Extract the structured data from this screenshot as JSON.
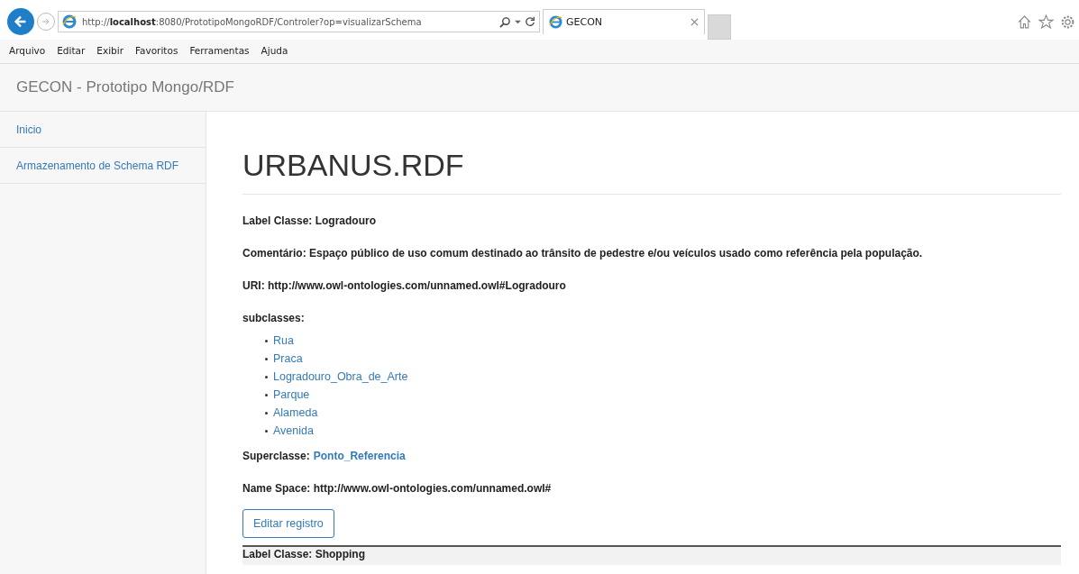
{
  "browser": {
    "address": {
      "prefix": "http://",
      "host": "localhost",
      "rest": ":8080/PrototipoMongoRDF/Controler?op=visualizarSchema"
    },
    "tabs": [
      {
        "label": "GECON",
        "selected": true
      }
    ],
    "menu": [
      "Arquivo",
      "Editar",
      "Exibir",
      "Favoritos",
      "Ferramentas",
      "Ajuda"
    ]
  },
  "navbar": {
    "brand": "GECON - Prototipo Mongo/RDF"
  },
  "sidebar": {
    "items": [
      {
        "label": "Inicio",
        "selected": false
      },
      {
        "label": "Armazenamento de Schema RDF",
        "selected": false
      }
    ]
  },
  "content": {
    "title": "URBANUS.RDF",
    "fields": [
      {
        "kind": "text",
        "label": "Label Classe:",
        "value": "Logradouro"
      },
      {
        "kind": "text",
        "label": "Comentário:",
        "value": "Espaço público de uso comum destinado ao trânsito de pedestre e/ou veículos usado como referência pela população."
      },
      {
        "kind": "text",
        "label": "URI:",
        "value": "http://www.owl-ontologies.com/unnamed.owl#Logradouro"
      },
      {
        "kind": "list",
        "label": "subclasses:",
        "items": [
          "Rua",
          "Praca",
          "Logradouro_Obra_de_Arte",
          "Parque",
          "Alameda",
          "Avenida"
        ]
      },
      {
        "kind": "link",
        "label": "Superclasse:",
        "value": "Ponto_Referencia"
      },
      {
        "kind": "text",
        "label": "Name Space:",
        "value": "http://www.owl-ontologies.com/unnamed.owl#"
      }
    ],
    "button": "Editar registro",
    "next": "Label Classe: Shopping"
  }
}
